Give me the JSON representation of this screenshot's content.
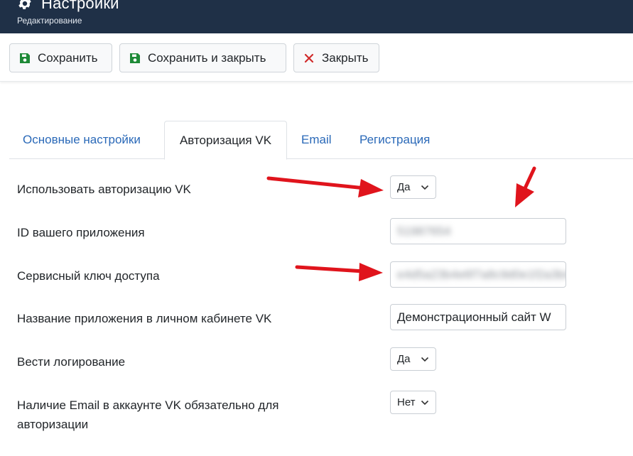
{
  "header": {
    "title": "Настройки",
    "subtitle": "Редактирование",
    "icon": "gear-icon",
    "background": "#1f3047"
  },
  "toolbar": {
    "save_label": "Сохранить",
    "save_close_label": "Сохранить и закрыть",
    "close_label": "Закрыть",
    "save_icon": "floppy-disk-icon",
    "close_icon": "close-x-icon",
    "save_icon_color": "#1e8a37",
    "close_icon_color": "#d12b2b"
  },
  "tabs": [
    {
      "label": "Основные настройки",
      "active": false
    },
    {
      "label": "Авторизация VK",
      "active": true
    },
    {
      "label": "Email",
      "active": false
    },
    {
      "label": "Регистрация",
      "active": false
    }
  ],
  "form": {
    "use_vk_auth": {
      "label": "Использовать авторизацию VK",
      "value": "Да"
    },
    "app_id": {
      "label": "ID вашего приложения",
      "value": "51987654"
    },
    "service_key": {
      "label": "Сервисный ключ доступа",
      "value": "e4d5a23b4e6f7a8c9d0e1f2a3b4c"
    },
    "app_name": {
      "label": "Название приложения в личном кабинете VK",
      "value": "Демонстрационный сайт W"
    },
    "logging": {
      "label": "Вести логирование",
      "value": "Да"
    },
    "email_required": {
      "label_line1": "Наличие Email в аккаунте VK обязательно для",
      "label_line2": "авторизации",
      "value": "Нет"
    }
  },
  "annotation_arrow_color": "#e0141c"
}
